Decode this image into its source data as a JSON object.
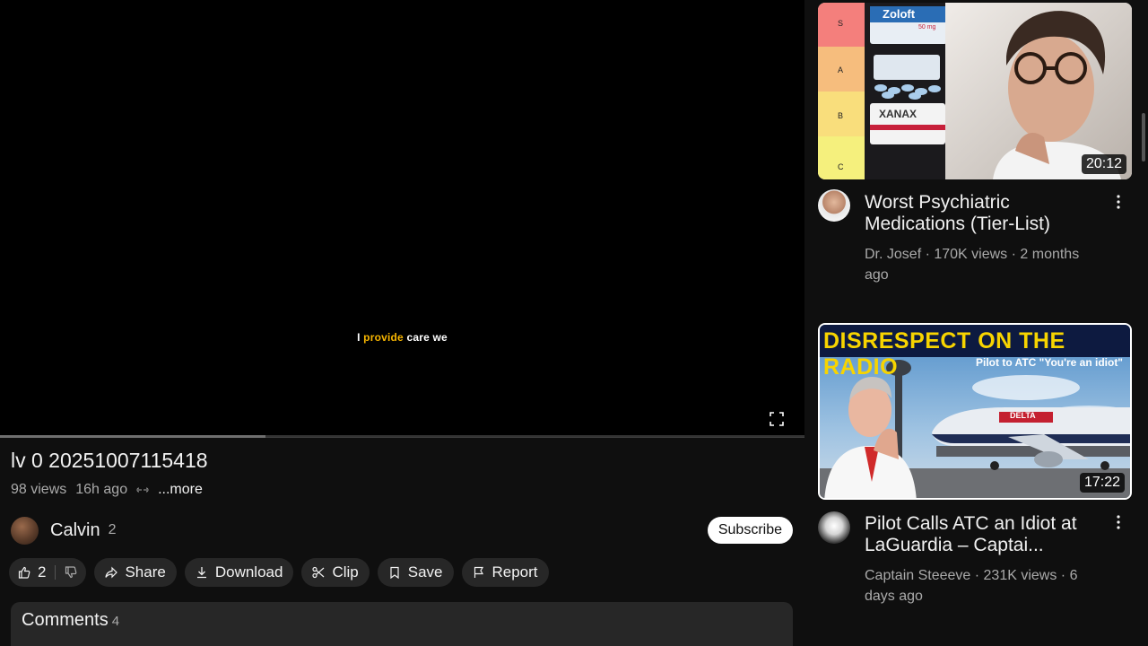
{
  "player": {
    "caption_before": "I ",
    "caption_highlight": "provide",
    "caption_after": " care we",
    "progress_fraction": 0.33
  },
  "video": {
    "title": "lv 0 20251007115418",
    "views": "98 views",
    "age": "16h ago",
    "more": "...more"
  },
  "channel": {
    "name": "Calvin",
    "subscribers": "2",
    "subscribe_label": "Subscribe"
  },
  "actions": {
    "like_count": "2",
    "share": "Share",
    "download": "Download",
    "clip": "Clip",
    "save": "Save",
    "report": "Report"
  },
  "comments": {
    "title": "Comments",
    "count": "4"
  },
  "related": [
    {
      "title": "Worst Psychiatric Medications (Tier-List)",
      "meta": "Dr. Josef · 170K views · 2 months ago",
      "duration": "20:12",
      "thumb_text": {
        "tiers": [
          "S",
          "A",
          "B",
          "C"
        ],
        "pill1": "Zoloft",
        "pill1_sub": "50 mg",
        "pill3": "XANAX"
      }
    },
    {
      "title": "Pilot Calls ATC an Idiot at LaGuardia – Captai...",
      "meta": "Captain Steeeve · 231K views · 6 days ago",
      "duration": "17:22",
      "thumb_text": {
        "headline": "DISRESPECT ON THE RADIO",
        "subline": "Pilot to ATC \"You're an idiot\"",
        "livery": "DELTA"
      }
    }
  ],
  "colors": {
    "background": "#0f0f0f",
    "pill": "#272727",
    "caption_highlight": "#f5b400",
    "headline_yellow": "#f7d400"
  }
}
